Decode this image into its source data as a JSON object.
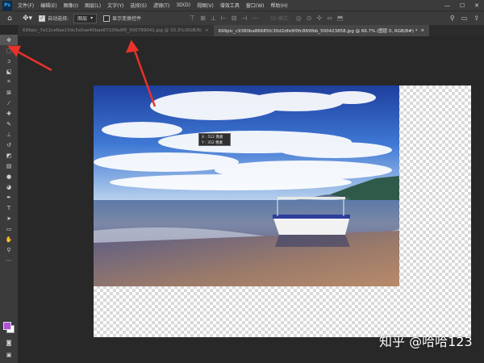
{
  "app": {
    "logo": "Ps"
  },
  "menu": [
    "文件(F)",
    "编辑(E)",
    "图像(I)",
    "图层(L)",
    "文字(Y)",
    "选择(S)",
    "滤镜(T)",
    "3D(D)",
    "视图(V)",
    "增效工具",
    "窗口(W)",
    "帮助(H)"
  ],
  "window_buttons": [
    "—",
    "☐",
    "✕"
  ],
  "options": {
    "auto_select_label": "自动选择:",
    "auto_select_value": "图层",
    "transform_label": "显示变换控件",
    "mode3d_label": "3D 模式:"
  },
  "tabs": [
    {
      "label": "699pic_7e12ce8ae15dc5a5ae40bae67100e9f5_500789041.jpg @ 33.3%(RGB/8)",
      "close": "×"
    },
    {
      "label": "699pic_c9380ba86685fc30d2dfe9f0fc869fbb_500423858.jpg @ 66.7% (图层 0, RGB/8#) *",
      "close": "×"
    }
  ],
  "tools": [
    {
      "icon": "move-icon",
      "glyph": "✥"
    },
    {
      "icon": "marquee-icon",
      "glyph": "⬚"
    },
    {
      "icon": "lasso-icon",
      "glyph": "ↄ"
    },
    {
      "icon": "object-select-icon",
      "glyph": "⬕"
    },
    {
      "icon": "crop-icon",
      "glyph": "⌗"
    },
    {
      "icon": "frame-icon",
      "glyph": "⊠"
    },
    {
      "icon": "eyedropper-icon",
      "glyph": "⁄"
    },
    {
      "icon": "healing-icon",
      "glyph": "✚"
    },
    {
      "icon": "brush-icon",
      "glyph": "✎"
    },
    {
      "icon": "stamp-icon",
      "glyph": "⊥"
    },
    {
      "icon": "history-brush-icon",
      "glyph": "↺"
    },
    {
      "icon": "eraser-icon",
      "glyph": "◩"
    },
    {
      "icon": "gradient-icon",
      "glyph": "▤"
    },
    {
      "icon": "blur-icon",
      "glyph": "●"
    },
    {
      "icon": "dodge-icon",
      "glyph": "◕"
    },
    {
      "icon": "pen-icon",
      "glyph": "✒"
    },
    {
      "icon": "type-icon",
      "glyph": "T"
    },
    {
      "icon": "path-select-icon",
      "glyph": "➤"
    },
    {
      "icon": "shape-icon",
      "glyph": "▭"
    },
    {
      "icon": "hand-icon",
      "glyph": "✋"
    },
    {
      "icon": "zoom-icon",
      "glyph": "⚲"
    },
    {
      "icon": "more-tools-icon",
      "glyph": "⋯"
    }
  ],
  "bottom_tools": [
    {
      "icon": "quick-mask-icon",
      "glyph": "◙"
    },
    {
      "icon": "screen-mode-icon",
      "glyph": "▣"
    }
  ],
  "colors": {
    "foreground": "#b050d8",
    "background": "#ffffff"
  },
  "info_box": {
    "x": "X : 512 像素",
    "y": "Y : 352 像素"
  },
  "watermark": "知乎 @哈哈123"
}
